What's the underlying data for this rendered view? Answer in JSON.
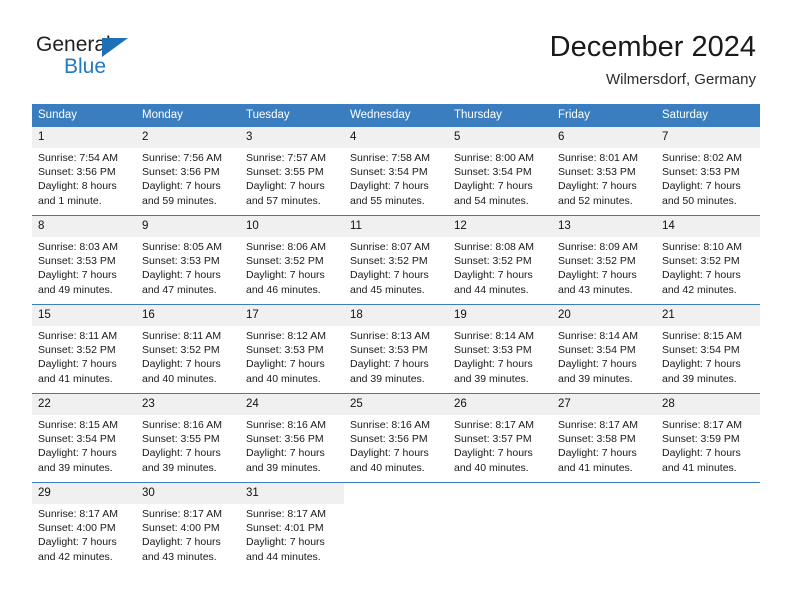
{
  "brand": {
    "name_part1": "General",
    "name_part2": "Blue",
    "triangle_color": "#1d70b8",
    "blue_color": "#1f7ac4"
  },
  "header": {
    "month_title": "December 2024",
    "location": "Wilmersdorf, Germany"
  },
  "theme": {
    "header_blue": "#3a7ebf",
    "daynum_band": "#f0f0f0",
    "text": "#1a1a1a"
  },
  "calendar": {
    "weekday_headers": [
      "Sunday",
      "Monday",
      "Tuesday",
      "Wednesday",
      "Thursday",
      "Friday",
      "Saturday"
    ],
    "weeks": [
      [
        {
          "day": "1",
          "sunrise": "Sunrise: 7:54 AM",
          "sunset": "Sunset: 3:56 PM",
          "daylight1": "Daylight: 8 hours",
          "daylight2": "and 1 minute."
        },
        {
          "day": "2",
          "sunrise": "Sunrise: 7:56 AM",
          "sunset": "Sunset: 3:56 PM",
          "daylight1": "Daylight: 7 hours",
          "daylight2": "and 59 minutes."
        },
        {
          "day": "3",
          "sunrise": "Sunrise: 7:57 AM",
          "sunset": "Sunset: 3:55 PM",
          "daylight1": "Daylight: 7 hours",
          "daylight2": "and 57 minutes."
        },
        {
          "day": "4",
          "sunrise": "Sunrise: 7:58 AM",
          "sunset": "Sunset: 3:54 PM",
          "daylight1": "Daylight: 7 hours",
          "daylight2": "and 55 minutes."
        },
        {
          "day": "5",
          "sunrise": "Sunrise: 8:00 AM",
          "sunset": "Sunset: 3:54 PM",
          "daylight1": "Daylight: 7 hours",
          "daylight2": "and 54 minutes."
        },
        {
          "day": "6",
          "sunrise": "Sunrise: 8:01 AM",
          "sunset": "Sunset: 3:53 PM",
          "daylight1": "Daylight: 7 hours",
          "daylight2": "and 52 minutes."
        },
        {
          "day": "7",
          "sunrise": "Sunrise: 8:02 AM",
          "sunset": "Sunset: 3:53 PM",
          "daylight1": "Daylight: 7 hours",
          "daylight2": "and 50 minutes."
        }
      ],
      [
        {
          "day": "8",
          "sunrise": "Sunrise: 8:03 AM",
          "sunset": "Sunset: 3:53 PM",
          "daylight1": "Daylight: 7 hours",
          "daylight2": "and 49 minutes."
        },
        {
          "day": "9",
          "sunrise": "Sunrise: 8:05 AM",
          "sunset": "Sunset: 3:53 PM",
          "daylight1": "Daylight: 7 hours",
          "daylight2": "and 47 minutes."
        },
        {
          "day": "10",
          "sunrise": "Sunrise: 8:06 AM",
          "sunset": "Sunset: 3:52 PM",
          "daylight1": "Daylight: 7 hours",
          "daylight2": "and 46 minutes."
        },
        {
          "day": "11",
          "sunrise": "Sunrise: 8:07 AM",
          "sunset": "Sunset: 3:52 PM",
          "daylight1": "Daylight: 7 hours",
          "daylight2": "and 45 minutes."
        },
        {
          "day": "12",
          "sunrise": "Sunrise: 8:08 AM",
          "sunset": "Sunset: 3:52 PM",
          "daylight1": "Daylight: 7 hours",
          "daylight2": "and 44 minutes."
        },
        {
          "day": "13",
          "sunrise": "Sunrise: 8:09 AM",
          "sunset": "Sunset: 3:52 PM",
          "daylight1": "Daylight: 7 hours",
          "daylight2": "and 43 minutes."
        },
        {
          "day": "14",
          "sunrise": "Sunrise: 8:10 AM",
          "sunset": "Sunset: 3:52 PM",
          "daylight1": "Daylight: 7 hours",
          "daylight2": "and 42 minutes."
        }
      ],
      [
        {
          "day": "15",
          "sunrise": "Sunrise: 8:11 AM",
          "sunset": "Sunset: 3:52 PM",
          "daylight1": "Daylight: 7 hours",
          "daylight2": "and 41 minutes."
        },
        {
          "day": "16",
          "sunrise": "Sunrise: 8:11 AM",
          "sunset": "Sunset: 3:52 PM",
          "daylight1": "Daylight: 7 hours",
          "daylight2": "and 40 minutes."
        },
        {
          "day": "17",
          "sunrise": "Sunrise: 8:12 AM",
          "sunset": "Sunset: 3:53 PM",
          "daylight1": "Daylight: 7 hours",
          "daylight2": "and 40 minutes."
        },
        {
          "day": "18",
          "sunrise": "Sunrise: 8:13 AM",
          "sunset": "Sunset: 3:53 PM",
          "daylight1": "Daylight: 7 hours",
          "daylight2": "and 39 minutes."
        },
        {
          "day": "19",
          "sunrise": "Sunrise: 8:14 AM",
          "sunset": "Sunset: 3:53 PM",
          "daylight1": "Daylight: 7 hours",
          "daylight2": "and 39 minutes."
        },
        {
          "day": "20",
          "sunrise": "Sunrise: 8:14 AM",
          "sunset": "Sunset: 3:54 PM",
          "daylight1": "Daylight: 7 hours",
          "daylight2": "and 39 minutes."
        },
        {
          "day": "21",
          "sunrise": "Sunrise: 8:15 AM",
          "sunset": "Sunset: 3:54 PM",
          "daylight1": "Daylight: 7 hours",
          "daylight2": "and 39 minutes."
        }
      ],
      [
        {
          "day": "22",
          "sunrise": "Sunrise: 8:15 AM",
          "sunset": "Sunset: 3:54 PM",
          "daylight1": "Daylight: 7 hours",
          "daylight2": "and 39 minutes."
        },
        {
          "day": "23",
          "sunrise": "Sunrise: 8:16 AM",
          "sunset": "Sunset: 3:55 PM",
          "daylight1": "Daylight: 7 hours",
          "daylight2": "and 39 minutes."
        },
        {
          "day": "24",
          "sunrise": "Sunrise: 8:16 AM",
          "sunset": "Sunset: 3:56 PM",
          "daylight1": "Daylight: 7 hours",
          "daylight2": "and 39 minutes."
        },
        {
          "day": "25",
          "sunrise": "Sunrise: 8:16 AM",
          "sunset": "Sunset: 3:56 PM",
          "daylight1": "Daylight: 7 hours",
          "daylight2": "and 40 minutes."
        },
        {
          "day": "26",
          "sunrise": "Sunrise: 8:17 AM",
          "sunset": "Sunset: 3:57 PM",
          "daylight1": "Daylight: 7 hours",
          "daylight2": "and 40 minutes."
        },
        {
          "day": "27",
          "sunrise": "Sunrise: 8:17 AM",
          "sunset": "Sunset: 3:58 PM",
          "daylight1": "Daylight: 7 hours",
          "daylight2": "and 41 minutes."
        },
        {
          "day": "28",
          "sunrise": "Sunrise: 8:17 AM",
          "sunset": "Sunset: 3:59 PM",
          "daylight1": "Daylight: 7 hours",
          "daylight2": "and 41 minutes."
        }
      ],
      [
        {
          "day": "29",
          "sunrise": "Sunrise: 8:17 AM",
          "sunset": "Sunset: 4:00 PM",
          "daylight1": "Daylight: 7 hours",
          "daylight2": "and 42 minutes."
        },
        {
          "day": "30",
          "sunrise": "Sunrise: 8:17 AM",
          "sunset": "Sunset: 4:00 PM",
          "daylight1": "Daylight: 7 hours",
          "daylight2": "and 43 minutes."
        },
        {
          "day": "31",
          "sunrise": "Sunrise: 8:17 AM",
          "sunset": "Sunset: 4:01 PM",
          "daylight1": "Daylight: 7 hours",
          "daylight2": "and 44 minutes."
        },
        {
          "day": "",
          "sunrise": "",
          "sunset": "",
          "daylight1": "",
          "daylight2": ""
        },
        {
          "day": "",
          "sunrise": "",
          "sunset": "",
          "daylight1": "",
          "daylight2": ""
        },
        {
          "day": "",
          "sunrise": "",
          "sunset": "",
          "daylight1": "",
          "daylight2": ""
        },
        {
          "day": "",
          "sunrise": "",
          "sunset": "",
          "daylight1": "",
          "daylight2": ""
        }
      ]
    ]
  }
}
